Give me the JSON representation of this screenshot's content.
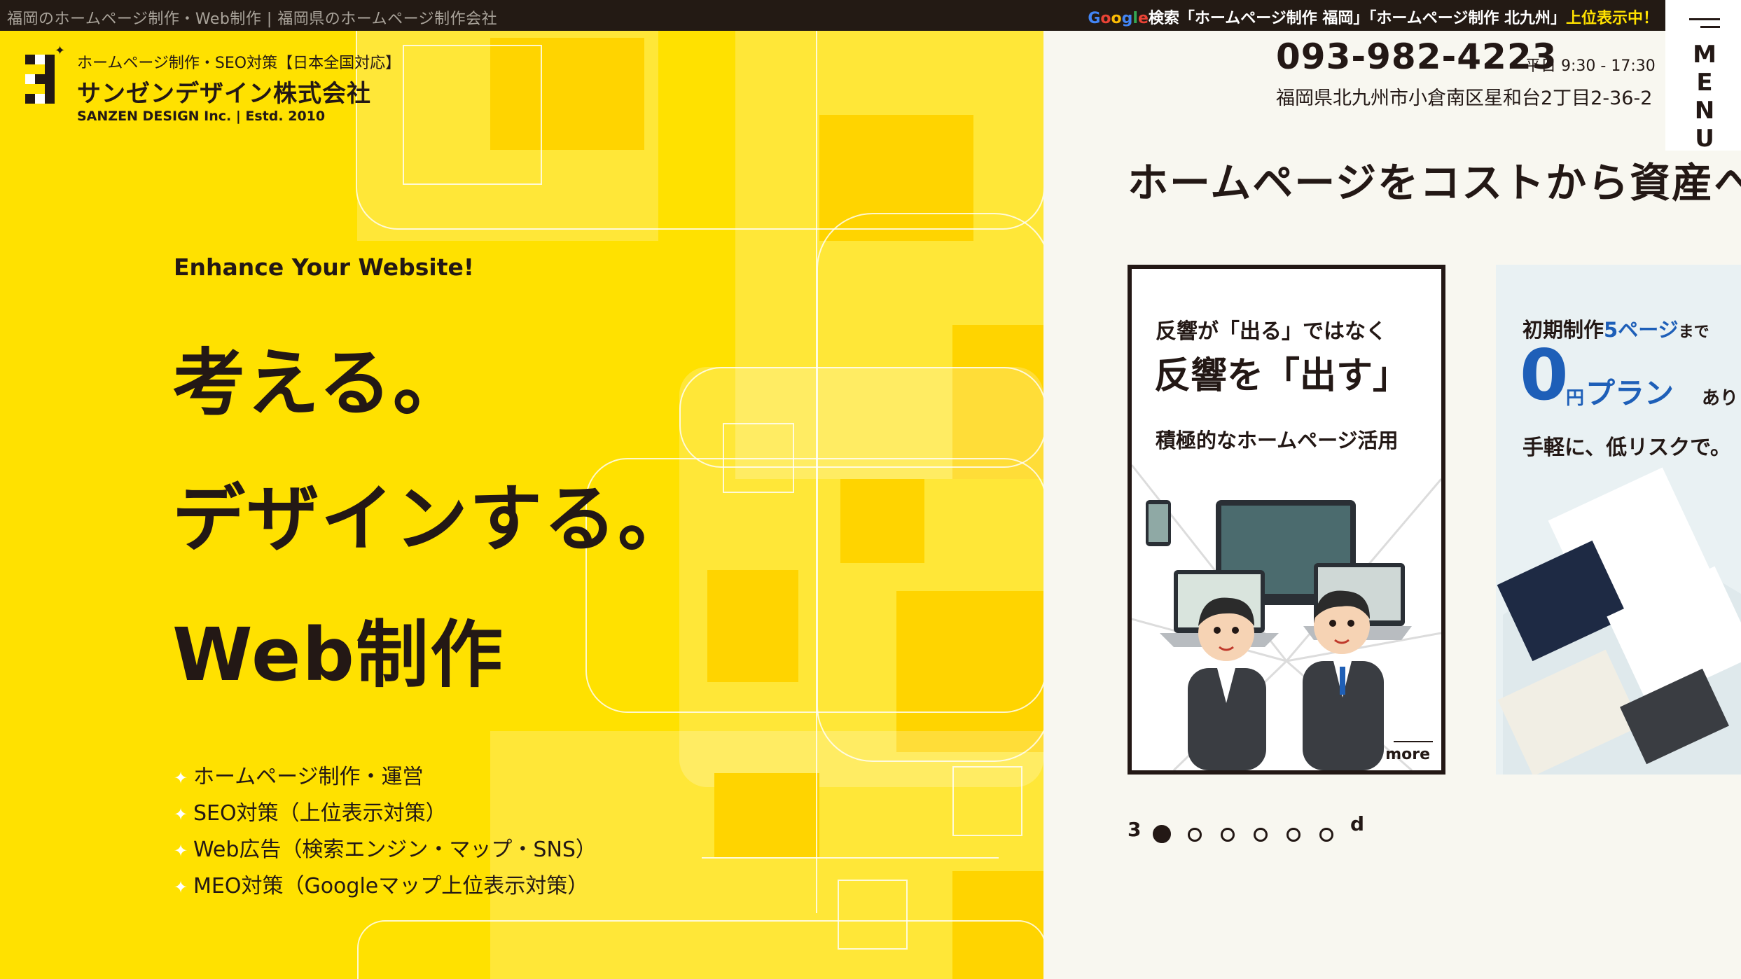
{
  "topbar": {
    "tagline": "福岡のホームページ制作・Web制作 | 福岡県のホームページ制作会社",
    "google_word": [
      "G",
      "o",
      "o",
      "g",
      "l",
      "e"
    ],
    "search_text": "検索「ホームページ制作 福岡」「ホームページ制作 北九州」",
    "highlight": "上位表示中！"
  },
  "menu": {
    "label": "MENU"
  },
  "logo": {
    "sub": "ホームページ制作・SEO対策【日本全国対応】",
    "name": "サンゼンデザイン株式会社",
    "en": "SANZEN DESIGN Inc. | Estd. 2010"
  },
  "hero": {
    "enhance": "Enhance Your Website!",
    "catch1": "考える。",
    "catch2": "デザインする。",
    "catch3": "Web制作",
    "services": [
      "ホームページ制作・運営",
      "SEO対策（上位表示対策）",
      "Web広告（検索エンジン・マップ・SNS）",
      "MEO対策（Googleマップ上位表示対策）"
    ]
  },
  "contact": {
    "phone": "093-982-4223",
    "hours": "平日 9:30 - 17:30",
    "address": "福岡県北九州市小倉南区星和台2丁目2-36-2"
  },
  "headline": "ホームページをコストから資産へ",
  "cards": {
    "card1": {
      "pre": "反響が「出る」ではなく",
      "main": "反響を「出す」",
      "sub": "積極的なホームページ活用",
      "more": "more"
    },
    "card2": {
      "pre_a": "初期制作",
      "pre_b": "5ページ",
      "pre_c": "まで",
      "big": "0",
      "yen": "円",
      "plan": "プラン",
      "ari": "あり",
      "easy": "手軽に、低リスクで。"
    }
  },
  "pager": {
    "start": "3",
    "end": "d",
    "count": 7,
    "active_index": 0
  },
  "colors": {
    "brand_yellow": "#ffe100",
    "ink": "#231815",
    "accent_blue": "#1e5fb8"
  }
}
